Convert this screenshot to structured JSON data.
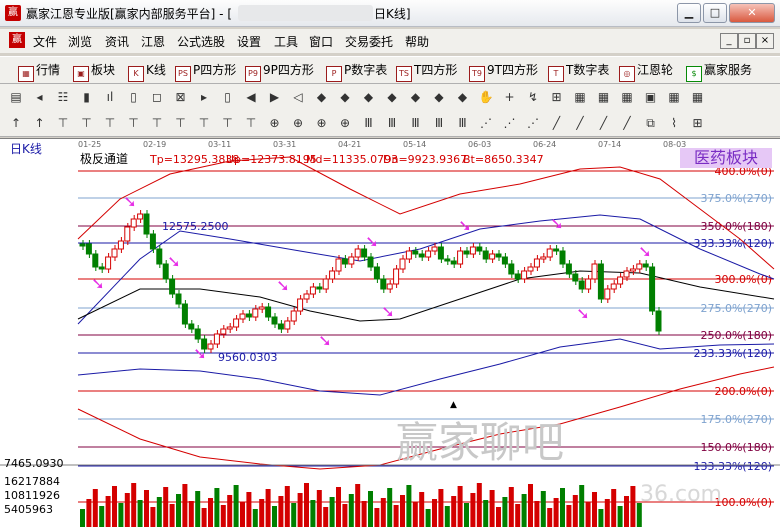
{
  "window": {
    "title": "赢家江恩专业版[赢家内部服务平台] - [",
    "title_end": "日K线]",
    "app_icon": "赢"
  },
  "window_buttons": {
    "minimize": "▁",
    "maximize": "□",
    "close": "✕"
  },
  "menu": {
    "logo": "赢",
    "items": [
      "文件",
      "浏览",
      "资讯",
      "江恩",
      "公式选股",
      "设置",
      "工具",
      "窗口",
      "交易委托",
      "帮助"
    ]
  },
  "mdi_buttons": [
    "_",
    "▫",
    "×"
  ],
  "toolbar1": {
    "items": [
      {
        "icon": "grid-icon",
        "glyph": "▦",
        "label": "行情"
      },
      {
        "icon": "block-icon",
        "glyph": "▣",
        "label": "板块"
      },
      {
        "icon": "kline-icon",
        "glyph": "K",
        "label": "K线"
      },
      {
        "icon": "p-square-icon",
        "glyph": "PS",
        "label": "P四方形"
      },
      {
        "icon": "9p-square-icon",
        "glyph": "P9",
        "label": "9P四方形"
      },
      {
        "icon": "p-digit-icon",
        "glyph": "P",
        "label": "P数字表"
      },
      {
        "icon": "t-square-icon",
        "glyph": "TS",
        "label": "T四方形"
      },
      {
        "icon": "9t-square-icon",
        "glyph": "T9",
        "label": "9T四方形"
      },
      {
        "icon": "t-digit-icon",
        "glyph": "T",
        "label": "T数字表"
      },
      {
        "icon": "gann-wheel-icon",
        "glyph": "◎",
        "label": "江恩轮"
      },
      {
        "icon": "dollar-icon",
        "glyph": "$",
        "label": "赢家服务"
      }
    ]
  },
  "toolbar2": [
    "▤",
    "◂",
    "☷",
    "▮",
    "ıl",
    "▯",
    "◻",
    "⊠",
    "▸",
    "▯",
    "◀",
    "▶",
    "◁",
    "◆",
    "◆",
    "◆",
    "◆",
    "◆",
    "◆",
    "◆",
    "✋",
    "+",
    "↯",
    "⊞",
    "▦",
    "▦",
    "▦",
    "▣",
    "▦",
    "▦"
  ],
  "toolbar3": [
    "↑",
    "↑",
    "⊤",
    "⊤",
    "⊤",
    "⊤",
    "⊤",
    "⊤",
    "⊤",
    "⊤",
    "⊤",
    "⊕",
    "⊕",
    "⊕",
    "⊕",
    "Ⅲ",
    "Ⅲ",
    "Ⅲ",
    "Ⅲ",
    "Ⅲ",
    "⋰",
    "⋰",
    "⋰",
    "╱",
    "╱",
    "╱",
    "╱",
    "⧉",
    "⌇",
    "⊞"
  ],
  "chart": {
    "period_label": "日K线",
    "indicator_name": "极反通道",
    "tp": "Tp=13295.3838",
    "up": "Up=12373.8195",
    "md": "Md=11335.0793",
    "dn": "Dn=9923.9367",
    "bt": "Bt=8650.3347",
    "sector_label": "医药板块",
    "dates": [
      "01-25",
      "02-19",
      "03-11",
      "03-31",
      "04-21",
      "05-14",
      "06-03",
      "06-24",
      "07-14",
      "08-03"
    ],
    "high_label": "12575.2500",
    "low_label": "9560.0303",
    "levels": [
      {
        "label": "400.0%(0)",
        "color": "#d40000"
      },
      {
        "label": "375.0%(270)",
        "color": "#7fa3cf"
      },
      {
        "label": "350.0%(180)",
        "color": "#800040"
      },
      {
        "label": "333.33%(120)",
        "color": "#1a1aa6"
      },
      {
        "label": "300.0%(0)",
        "color": "#d40000"
      },
      {
        "label": "275.0%(270)",
        "color": "#7fa3cf"
      },
      {
        "label": "250.0%(180)",
        "color": "#800040"
      },
      {
        "label": "233.33%(120)",
        "color": "#1a1aa6"
      },
      {
        "label": "200.0%(0)",
        "color": "#d40000"
      },
      {
        "label": "175.0%(270)",
        "color": "#7fa3cf"
      },
      {
        "label": "150.0%(180)",
        "color": "#800040"
      },
      {
        "label": "133.33%(120)",
        "color": "#1a1aa6"
      },
      {
        "label": "100.0%(0)",
        "color": "#d40000"
      }
    ],
    "volume_scale": [
      "7465.0930",
      "16217884",
      "10811926",
      "5405963"
    ],
    "watermark": "赢家聊吧",
    "watermark_url": "36.com",
    "colors": {
      "up": "#d40000",
      "down": "#007f00",
      "upper_band": "#d40000",
      "mid_band": "#1a1aa6",
      "center": "#000000",
      "arrow": "#e62ee6"
    }
  }
}
